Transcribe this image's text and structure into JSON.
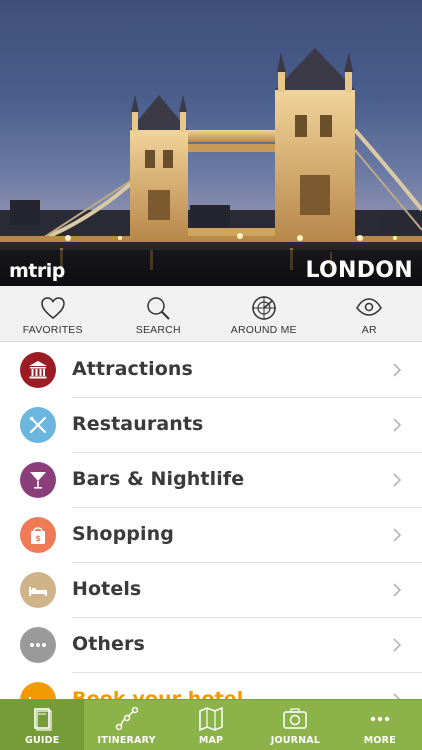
{
  "hero": {
    "logo": "mtrip",
    "city": "LONDON"
  },
  "quickbar": {
    "items": [
      {
        "label": "FAVORITES",
        "icon": "heart-icon"
      },
      {
        "label": "SEARCH",
        "icon": "magnifier-icon"
      },
      {
        "label": "AROUND ME",
        "icon": "radar-icon"
      },
      {
        "label": "AR",
        "icon": "eye-icon"
      }
    ]
  },
  "categories": [
    {
      "label": "Attractions",
      "icon": "museum-icon",
      "color": "#9b1c25"
    },
    {
      "label": "Restaurants",
      "icon": "fork-knife-icon",
      "color": "#6bb6df"
    },
    {
      "label": "Bars & Nightlife",
      "icon": "cocktail-icon",
      "color": "#8a3f7a"
    },
    {
      "label": "Shopping",
      "icon": "shopping-bag-icon",
      "color": "#ee7b55"
    },
    {
      "label": "Hotels",
      "icon": "bed-icon",
      "color": "#cfb48a"
    },
    {
      "label": "Others",
      "icon": "ellipsis-icon",
      "color": "#9a9a9a"
    },
    {
      "label": "Book your hotel",
      "icon": "hotel-booking-icon",
      "color": "#f39a00"
    }
  ],
  "tabbar": {
    "items": [
      {
        "label": "GUIDE",
        "icon": "book-icon",
        "active": true
      },
      {
        "label": "ITINERARY",
        "icon": "route-icon",
        "active": false
      },
      {
        "label": "MAP",
        "icon": "map-icon",
        "active": false
      },
      {
        "label": "JOURNAL",
        "icon": "camera-icon",
        "active": false
      },
      {
        "label": "MORE",
        "icon": "more-dots-icon",
        "active": false
      }
    ]
  },
  "colors": {
    "accent_green": "#8cb24a",
    "accent_green_active": "#769c38",
    "book_orange": "#f39a00",
    "text_dark": "#3a3a3a"
  }
}
